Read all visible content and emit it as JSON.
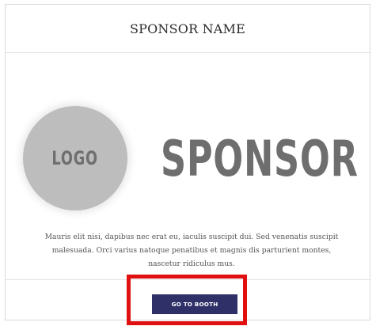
{
  "card": {
    "header_title": "SPONSOR NAME",
    "logo_text": "LOGO",
    "sponsor_wordmark": "SPONSOR",
    "description": "Mauris elit nisi, dapibus nec erat eu, iaculis suscipit dui. Sed venenatis suscipit malesuada. Orci varius natoque penatibus et magnis dis parturient montes, nascetur ridiculus mus.",
    "button_label": "GO TO BOOTH"
  },
  "colors": {
    "button_bg": "#2f3068",
    "highlight": "#e01010",
    "logo_circle": "#bdbdbd",
    "wordmark": "#6e6e6e"
  }
}
